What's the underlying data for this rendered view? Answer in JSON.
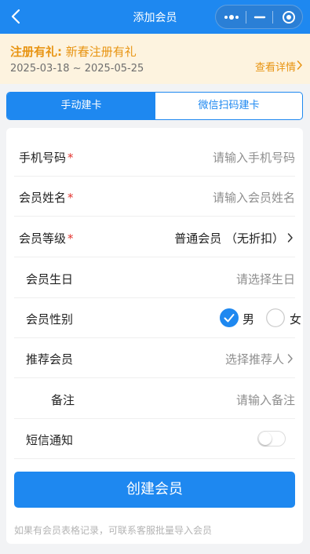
{
  "nav": {
    "title": "添加会员",
    "icons": [
      "chevron-left-icon",
      "more-dots-icon",
      "minimize-icon",
      "target-icon"
    ]
  },
  "promo": {
    "title_bold": "注册有礼:",
    "title_text": "新春注册有礼",
    "date_range": "2025-03-18 ~ 2025-05-25",
    "detail_label": "查看详情"
  },
  "tabs": {
    "manual": "手动建卡",
    "wechat": "微信扫码建卡",
    "active": "manual"
  },
  "form": {
    "phone": {
      "label": "手机号码",
      "required": "*",
      "placeholder": "请输入手机号码"
    },
    "name": {
      "label": "会员姓名",
      "required": "*",
      "placeholder": "请输入会员姓名"
    },
    "level": {
      "label": "会员等级",
      "required": "*",
      "value": "普通会员 （无折扣）"
    },
    "birthday": {
      "label": "会员生日",
      "placeholder": "请选择生日"
    },
    "gender": {
      "label": "会员性别",
      "male": "男",
      "female": "女",
      "selected": "男"
    },
    "referrer": {
      "label": "推荐会员",
      "placeholder": "选择推荐人"
    },
    "remark": {
      "label": "备注",
      "placeholder": "请输入备注"
    },
    "sms": {
      "label": "短信通知",
      "enabled": false
    }
  },
  "submit_label": "创建会员",
  "hint": "如果有会员表格记录，可联系客服批量导入会员",
  "colors": {
    "primary": "#1e88f0",
    "promo_bg": "#fdf3df",
    "promo_text": "#e89412",
    "required": "#e3342f"
  }
}
